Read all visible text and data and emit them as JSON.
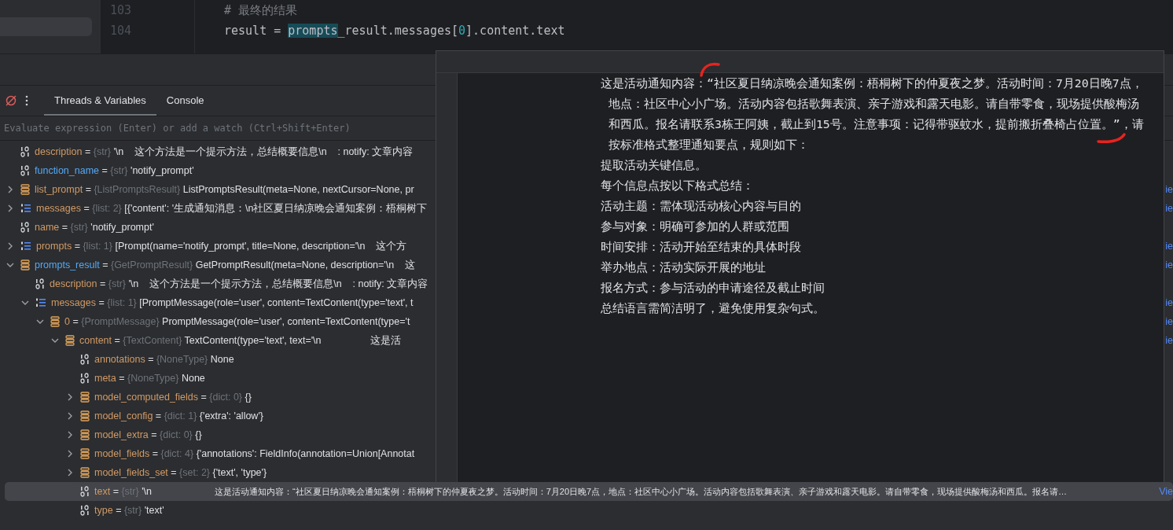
{
  "editor": {
    "lines": [
      {
        "number": "103",
        "tokens": [
          {
            "kind": "comment",
            "text": "# 最终的结果"
          }
        ]
      },
      {
        "number": "104",
        "tokens": [
          {
            "kind": "plain",
            "text": "result = "
          },
          {
            "kind": "usage",
            "text": "prompts"
          },
          {
            "kind": "plain",
            "text": "_result.messages["
          },
          {
            "kind": "number",
            "text": "0"
          },
          {
            "kind": "plain",
            "text": "].content.text"
          }
        ]
      }
    ]
  },
  "debugger": {
    "tabs": [
      {
        "label": "Threads & Variables",
        "selected": true
      },
      {
        "label": "Console",
        "selected": false
      }
    ],
    "evaluate": {
      "placeholder": "Evaluate expression (Enter) or add a watch (Ctrl+Shift+Enter)"
    },
    "variables": [
      {
        "kind": "str",
        "name": "description",
        "changed": false,
        "selected": false,
        "operator": "=",
        "type": "{str}",
        "value": "'\\n    这个方法是一个提示方法，总结概要信息\\n    : notify: 文章内容"
      },
      {
        "kind": "str",
        "name": "function_name",
        "changed": true,
        "selected": false,
        "operator": "=",
        "type": "{str}",
        "value": "'notify_prompt'"
      },
      {
        "kind": "object",
        "name": "list_prompt",
        "changed": false,
        "selected": false,
        "expanded": false,
        "operator": "=",
        "type": "{ListPromptsResult}",
        "value": "ListPromptsResult(meta=None, nextCursor=None, pr",
        "link": "ie"
      },
      {
        "kind": "list",
        "name": "messages",
        "changed": false,
        "selected": false,
        "expanded": false,
        "operator": "=",
        "type": "{list: 2}",
        "value": "[{'content': '生成通知消息：\\n社区夏日纳凉晚会通知案例：梧桐树下",
        "link": "ie"
      },
      {
        "kind": "str",
        "name": "name",
        "changed": false,
        "selected": false,
        "operator": "=",
        "type": "{str}",
        "value": "'notify_prompt'"
      },
      {
        "kind": "list",
        "name": "prompts",
        "changed": false,
        "selected": false,
        "expanded": false,
        "operator": "=",
        "type": "{list: 1}",
        "value": "[Prompt(name='notify_prompt', title=None, description='\\n    这个方",
        "link": "ie"
      },
      {
        "kind": "object",
        "name": "prompts_result",
        "changed": true,
        "selected": false,
        "expanded": true,
        "operator": "=",
        "type": "{GetPromptResult}",
        "value": "GetPromptResult(meta=None, description='\\n    这",
        "link": "ie",
        "children": [
          {
            "kind": "str",
            "name": "description",
            "changed": false,
            "selected": false,
            "operator": "=",
            "type": "{str}",
            "value": "'\\n    这个方法是一个提示方法，总结概要信息\\n    : notify: 文章内容"
          },
          {
            "kind": "list",
            "name": "messages",
            "changed": false,
            "selected": false,
            "expanded": true,
            "operator": "=",
            "type": "{list: 1}",
            "value": "[PromptMessage(role='user', content=TextContent(type='text', t",
            "link": "ie",
            "children": [
              {
                "kind": "object",
                "name": "0",
                "changed": false,
                "selected": false,
                "expanded": true,
                "operator": "=",
                "type": "{PromptMessage}",
                "value": "PromptMessage(role='user', content=TextContent(type='t",
                "link": "ie",
                "children": [
                  {
                    "kind": "object",
                    "name": "content",
                    "changed": false,
                    "selected": false,
                    "expanded": true,
                    "operator": "=",
                    "type": "{TextContent}",
                    "value": "TextContent(type='text', text='\\n                  这是活",
                    "link": "ie",
                    "children": [
                      {
                        "kind": "str",
                        "name": "annotations",
                        "changed": false,
                        "selected": false,
                        "operator": "=",
                        "type": "{NoneType}",
                        "value": "None"
                      },
                      {
                        "kind": "str",
                        "name": "meta",
                        "changed": false,
                        "selected": false,
                        "operator": "=",
                        "type": "{NoneType}",
                        "value": "None"
                      },
                      {
                        "kind": "object",
                        "name": "model_computed_fields",
                        "changed": false,
                        "selected": false,
                        "expanded": false,
                        "operator": "=",
                        "type": "{dict: 0}",
                        "value": "{}"
                      },
                      {
                        "kind": "object",
                        "name": "model_config",
                        "changed": false,
                        "selected": false,
                        "expanded": false,
                        "operator": "=",
                        "type": "{dict: 1}",
                        "value": "{'extra': 'allow'}"
                      },
                      {
                        "kind": "object",
                        "name": "model_extra",
                        "changed": false,
                        "selected": false,
                        "expanded": false,
                        "operator": "=",
                        "type": "{dict: 0}",
                        "value": "{}"
                      },
                      {
                        "kind": "object",
                        "name": "model_fields",
                        "changed": false,
                        "selected": false,
                        "expanded": false,
                        "operator": "=",
                        "type": "{dict: 4}",
                        "value": "{'annotations': FieldInfo(annotation=Union[Annotat"
                      },
                      {
                        "kind": "object",
                        "name": "model_fields_set",
                        "changed": false,
                        "selected": false,
                        "expanded": false,
                        "operator": "=",
                        "type": "{set: 2}",
                        "value": "{'text', 'type'}"
                      },
                      {
                        "kind": "str",
                        "name": "text",
                        "changed": false,
                        "selected": true,
                        "operator": "=",
                        "type": "{str}",
                        "value": "'\\n",
                        "preview": "这是活动通知内容：“社区夏日纳凉晚会通知案例：梧桐树下的仲夏夜之梦。活动时间：7月20日晚7点，地点：社区中心小广场。活动内容包括歌舞表演、亲子游戏和露天电影。请自带零食，现场提供酸梅汤和西瓜。报名请…",
                        "link": "Vie"
                      },
                      {
                        "kind": "str",
                        "name": "type",
                        "changed": false,
                        "selected": false,
                        "operator": "=",
                        "type": "{str}",
                        "value": "'text'"
                      }
                    ]
                  }
                ]
              }
            ]
          }
        ]
      }
    ]
  },
  "popup": {
    "paragraphs": [
      {
        "lines": [
          "这是活动通知内容：“社区夏日纳凉晚会通知案例：梧桐树下的仲夏夜之梦。活动时间：7月20日晚7点，",
          "地点：社区中心小广场。活动内容包括歌舞表演、亲子游戏和露天电影。请自带零食，现场提供酸梅汤",
          "和西瓜。报名请联系3栋王阿姨，截止到15号。注意事项：记得带驱蚊水，提前搬折叠椅占位置。”，请",
          "按标准格式整理通知要点，规则如下："
        ]
      },
      {
        "lines": [
          "提取活动关键信息。"
        ]
      },
      {
        "lines": [
          "每个信息点按以下格式总结："
        ]
      },
      {
        "lines": [
          "活动主题：需体现活动核心内容与目的"
        ]
      },
      {
        "lines": [
          "参与对象：明确可参加的人群或范围"
        ]
      },
      {
        "lines": [
          "时间安排：活动开始至结束的具体时段"
        ]
      },
      {
        "lines": [
          "举办地点：活动实际开展的地址"
        ]
      },
      {
        "lines": [
          "报名方式：参与活动的申请途径及截止时间"
        ]
      },
      {
        "lines": [
          "总结语言需简洁明了，避免使用复杂句式。"
        ]
      }
    ]
  }
}
